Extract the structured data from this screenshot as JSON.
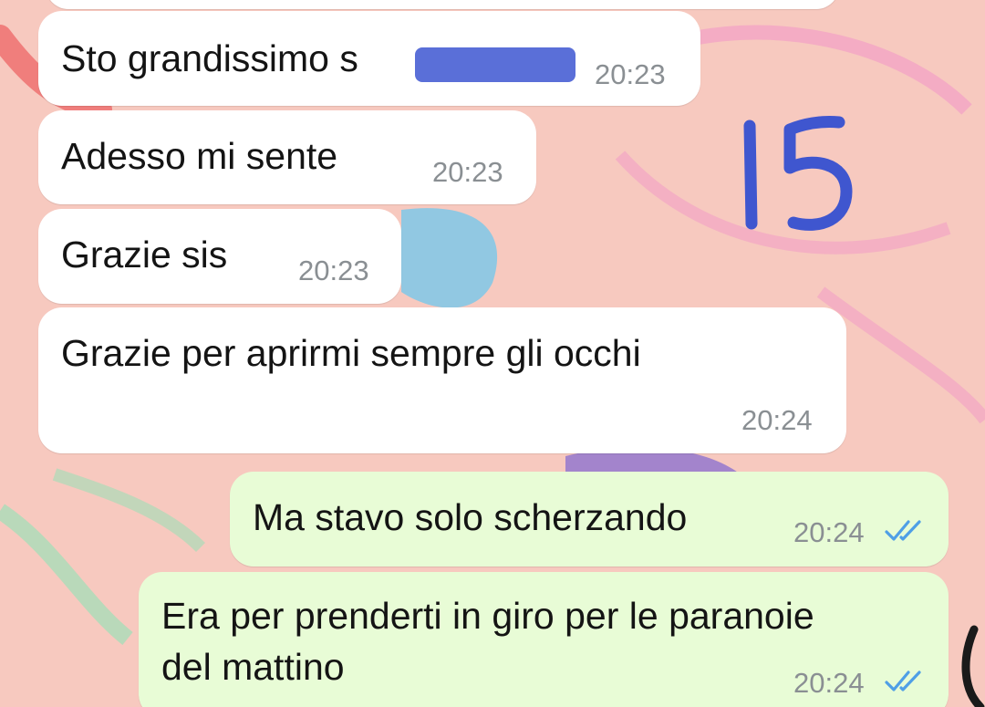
{
  "messages": [
    {
      "direction": "incoming",
      "text": "Sto grandissimo s",
      "time": "20:23",
      "redacted": true
    },
    {
      "direction": "incoming",
      "text": "Adesso mi sente",
      "time": "20:23"
    },
    {
      "direction": "incoming",
      "text": "Grazie sis",
      "time": "20:23"
    },
    {
      "direction": "incoming",
      "text": "Grazie per aprirmi sempre gli occhi",
      "time": "20:24"
    },
    {
      "direction": "outgoing",
      "text": "Ma stavo solo scherzando",
      "time": "20:24",
      "status": "read"
    },
    {
      "direction": "outgoing",
      "text_line1": "Era per prenderti in giro per le paranoie",
      "text_line2": "del mattino",
      "time": "20:24",
      "status": "read"
    }
  ],
  "overlay": {
    "handwritten_annotation": "15"
  },
  "colors": {
    "incoming_bubble": "#ffffff",
    "outgoing_bubble": "#e8fcd6",
    "read_ticks": "#4f9fe6",
    "redaction": "#5a6fd8",
    "wallpaper": "#f7c9bf"
  }
}
